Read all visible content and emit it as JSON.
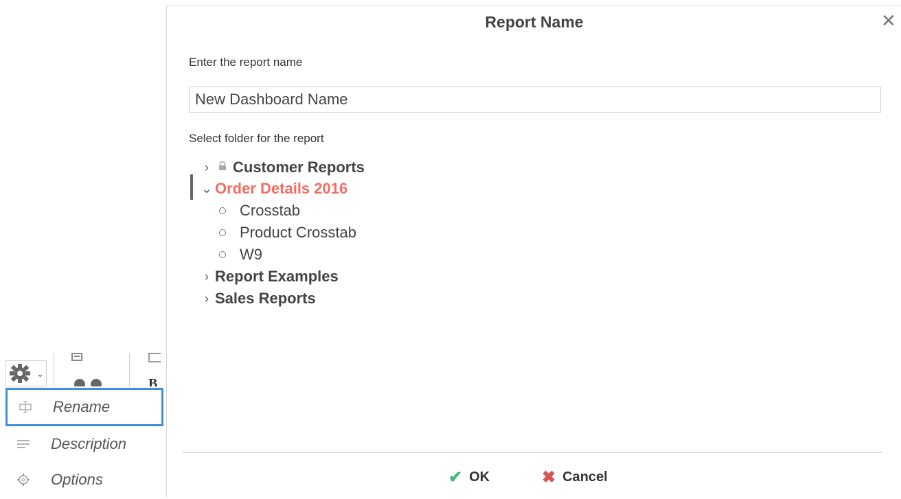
{
  "dialog": {
    "title": "Report Name",
    "name_label": "Enter the report name",
    "name_value": "New Dashboard Name",
    "folder_label": "Select folder for the report",
    "tree": {
      "customer_reports": "Customer Reports",
      "order_details": "Order Details 2016",
      "order_children": [
        "Crosstab",
        "Product Crosstab",
        "W9"
      ],
      "report_examples": "Report Examples",
      "sales_reports": "Sales Reports"
    },
    "ok_label": "OK",
    "cancel_label": "Cancel"
  },
  "context_menu": {
    "items": [
      {
        "label": "Rename",
        "icon": "rename-icon"
      },
      {
        "label": "Description",
        "icon": "description-icon"
      },
      {
        "label": "Options",
        "icon": "options-icon"
      }
    ]
  },
  "colors": {
    "selected_folder": "#f26d60",
    "ok_check": "#3cb878",
    "cancel_x": "#d9534f",
    "menu_focus": "#3d8fde"
  }
}
